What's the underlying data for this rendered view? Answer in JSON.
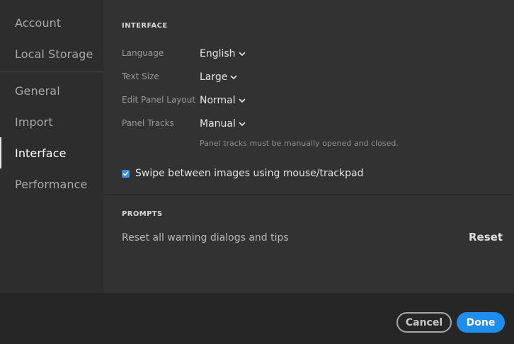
{
  "sidebar": {
    "items": [
      {
        "label": "Account"
      },
      {
        "label": "Local Storage"
      },
      {
        "label": "General"
      },
      {
        "label": "Import"
      },
      {
        "label": "Interface",
        "active": true
      },
      {
        "label": "Performance"
      }
    ]
  },
  "interface": {
    "title": "INTERFACE",
    "language": {
      "label": "Language",
      "value": "English"
    },
    "text_size": {
      "label": "Text Size",
      "value": "Large"
    },
    "edit_panel_layout": {
      "label": "Edit Panel Layout",
      "value": "Normal"
    },
    "panel_tracks": {
      "label": "Panel Tracks",
      "value": "Manual",
      "hint": "Panel tracks must be manually opened and closed."
    },
    "swipe": {
      "label": "Swipe between images using mouse/trackpad",
      "checked": true
    }
  },
  "prompts": {
    "title": "PROMPTS",
    "reset_label": "Reset all warning dialogs and tips",
    "reset_button": "Reset"
  },
  "footer": {
    "cancel": "Cancel",
    "done": "Done"
  },
  "colors": {
    "accent": "#1f8ded",
    "checkbox": "#3a8de0"
  },
  "icons": {
    "dropdown": "chevron-down-icon",
    "checkbox": "checkmark-icon"
  }
}
